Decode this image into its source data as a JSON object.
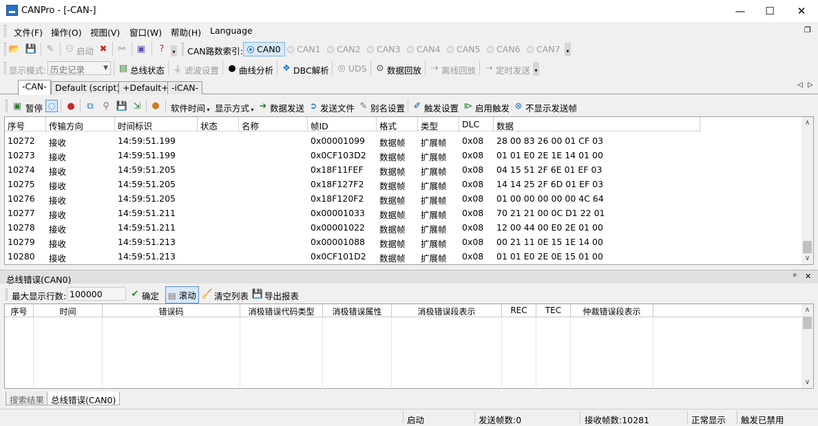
{
  "window": {
    "title": "CANPro - [-CAN-]",
    "buttons": {
      "minimize": "—",
      "maximize": "☐",
      "close": "✕"
    }
  },
  "menu": [
    "文件(F)",
    "操作(O)",
    "视图(V)",
    "窗口(W)",
    "帮助(H)",
    "Language"
  ],
  "toolbar1": {
    "start_label": "启动",
    "can_index_label": "CAN路数索引:",
    "channels": [
      "CAN0",
      "CAN1",
      "CAN2",
      "CAN3",
      "CAN4",
      "CAN5",
      "CAN6",
      "CAN7"
    ],
    "selected_channel": "CAN0"
  },
  "toolbar2": {
    "display_mode_label": "显示模式:",
    "display_mode_value": "历史记录",
    "bus_status": "总线状态",
    "filter_settings": "滤波设置",
    "curve_analysis": "曲线分析",
    "dbc_parse": "DBC解析",
    "uds": "UDS",
    "data_playback": "数据回放",
    "offline_playback": "离线回放",
    "timed_send": "定时发送"
  },
  "tabs": [
    "-CAN-",
    "Default (script)",
    "+Default+",
    "-iCAN-"
  ],
  "active_tab": "-CAN-",
  "toolbar3": {
    "pause": "暂停",
    "software_time": "软件时间",
    "display_mode": "显示方式",
    "data_send": "数据发送",
    "send_file": "发送文件",
    "alias_settings": "别名设置",
    "trigger_settings": "触发设置",
    "enable_trigger": "启用触发",
    "hide_send_frames": "不显示发送帧"
  },
  "frames_table": {
    "columns": [
      "序号",
      "传输方向",
      "时间标识",
      "状态",
      "名称",
      "帧ID",
      "格式",
      "类型",
      "DLC",
      "数据"
    ],
    "rows": [
      [
        "10272",
        "接收",
        "14:59:51.199",
        "",
        "",
        "0x00001099",
        "数据帧",
        "扩展帧",
        "0x08",
        "28 00 83 26 00 01 CF 03"
      ],
      [
        "10273",
        "接收",
        "14:59:51.199",
        "",
        "",
        "0x0CF103D2",
        "数据帧",
        "扩展帧",
        "0x08",
        "01 01 E0 2E 1E 14 01 00"
      ],
      [
        "10274",
        "接收",
        "14:59:51.205",
        "",
        "",
        "0x18F11FEF",
        "数据帧",
        "扩展帧",
        "0x08",
        "04 15 51 2F 6E 01 EF 03"
      ],
      [
        "10275",
        "接收",
        "14:59:51.205",
        "",
        "",
        "0x18F127F2",
        "数据帧",
        "扩展帧",
        "0x08",
        "14 14 25 2F 6D 01 EF 03"
      ],
      [
        "10276",
        "接收",
        "14:59:51.205",
        "",
        "",
        "0x18F120F2",
        "数据帧",
        "扩展帧",
        "0x08",
        "01 00 00 00 00 00 4C 64"
      ],
      [
        "10277",
        "接收",
        "14:59:51.211",
        "",
        "",
        "0x00001033",
        "数据帧",
        "扩展帧",
        "0x08",
        "70 21 21 00 0C D1 22 01"
      ],
      [
        "10278",
        "接收",
        "14:59:51.211",
        "",
        "",
        "0x00001022",
        "数据帧",
        "扩展帧",
        "0x08",
        "12 00 44 00 E0 2E 01 00"
      ],
      [
        "10279",
        "接收",
        "14:59:51.213",
        "",
        "",
        "0x00001088",
        "数据帧",
        "扩展帧",
        "0x08",
        "00 21 11 0E 15 1E 14 00"
      ],
      [
        "10280",
        "接收",
        "14:59:51.213",
        "",
        "",
        "0x0CF101D2",
        "数据帧",
        "扩展帧",
        "0x08",
        "01 01 E0 2E 0E 15 01 00"
      ]
    ]
  },
  "error_panel": {
    "title": "总线错误(CAN0)",
    "pin": "ᵖ",
    "close": "✕",
    "max_rows_label": "最大显示行数:",
    "max_rows_value": "100000",
    "confirm": "确定",
    "scroll": "滚动",
    "clear_list": "清空列表",
    "export_report": "导出报表",
    "columns": [
      "序号",
      "时间",
      "错误码",
      "消极错误代码类型",
      "消极错误属性",
      "消极错误段表示",
      "REC",
      "TEC",
      "仲裁错误段表示"
    ]
  },
  "bottom_tabs": [
    "搜索结果",
    "总线错误(CAN0)"
  ],
  "active_bottom_tab": "总线错误(CAN0)",
  "status": {
    "state": "启动",
    "sent_frames": "发送帧数:0",
    "received_frames": "接收帧数:10281",
    "display": "正常显示",
    "trigger": "触发已禁用"
  },
  "colors": {
    "accent": "#1e78d6",
    "selected_bg": "#d8e9fa"
  }
}
